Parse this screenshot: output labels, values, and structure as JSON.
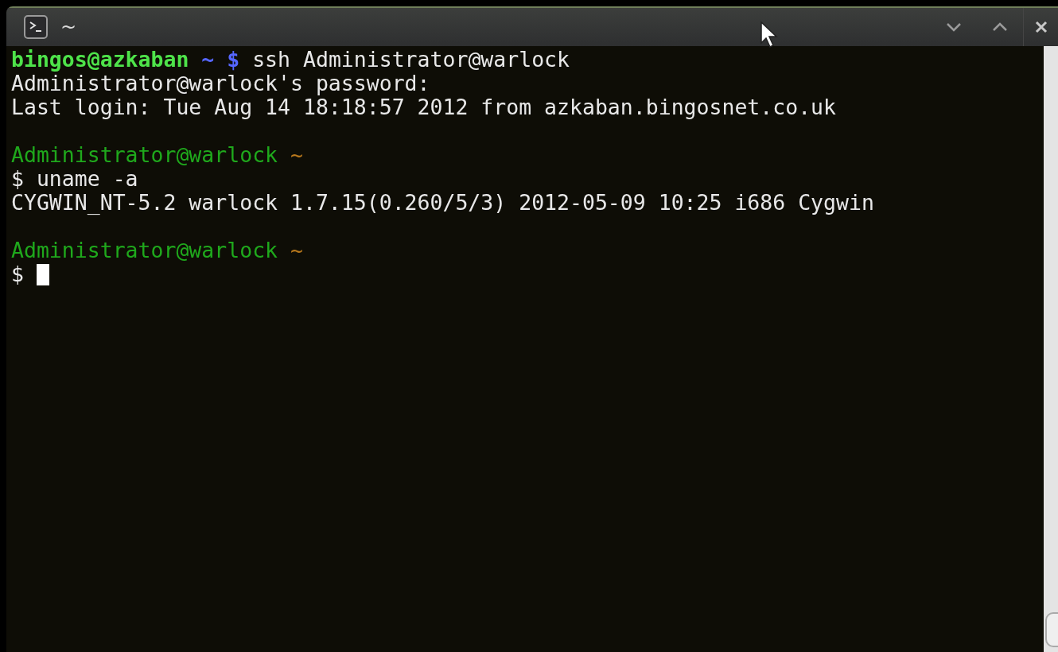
{
  "window": {
    "title": "~"
  },
  "terminal": {
    "lines": [
      [
        {
          "kind": "user",
          "text": "bingos@azkaban"
        },
        {
          "kind": "path",
          "text": " ~ $"
        },
        {
          "kind": "plain",
          "text": " ssh Administrator@warlock"
        }
      ],
      [
        {
          "kind": "plain",
          "text": "Administrator@warlock's password:"
        }
      ],
      [
        {
          "kind": "plain",
          "text": "Last login: Tue Aug 14 18:18:57 2012 from azkaban.bingosnet.co.uk"
        }
      ],
      [
        {
          "kind": "blank"
        }
      ],
      [
        {
          "kind": "remote-user",
          "text": "Administrator@warlock"
        },
        {
          "kind": "remote-path",
          "text": " ~"
        }
      ],
      [
        {
          "kind": "plain",
          "text": "$ uname -a"
        }
      ],
      [
        {
          "kind": "plain",
          "text": "CYGWIN_NT-5.2 warlock 1.7.15(0.260/5/3) 2012-05-09 10:25 i686 Cygwin"
        }
      ],
      [
        {
          "kind": "blank"
        }
      ],
      [
        {
          "kind": "remote-user",
          "text": "Administrator@warlock"
        },
        {
          "kind": "remote-path",
          "text": " ~"
        }
      ],
      [
        {
          "kind": "plain",
          "text": "$ "
        },
        {
          "kind": "cursor"
        }
      ]
    ]
  }
}
